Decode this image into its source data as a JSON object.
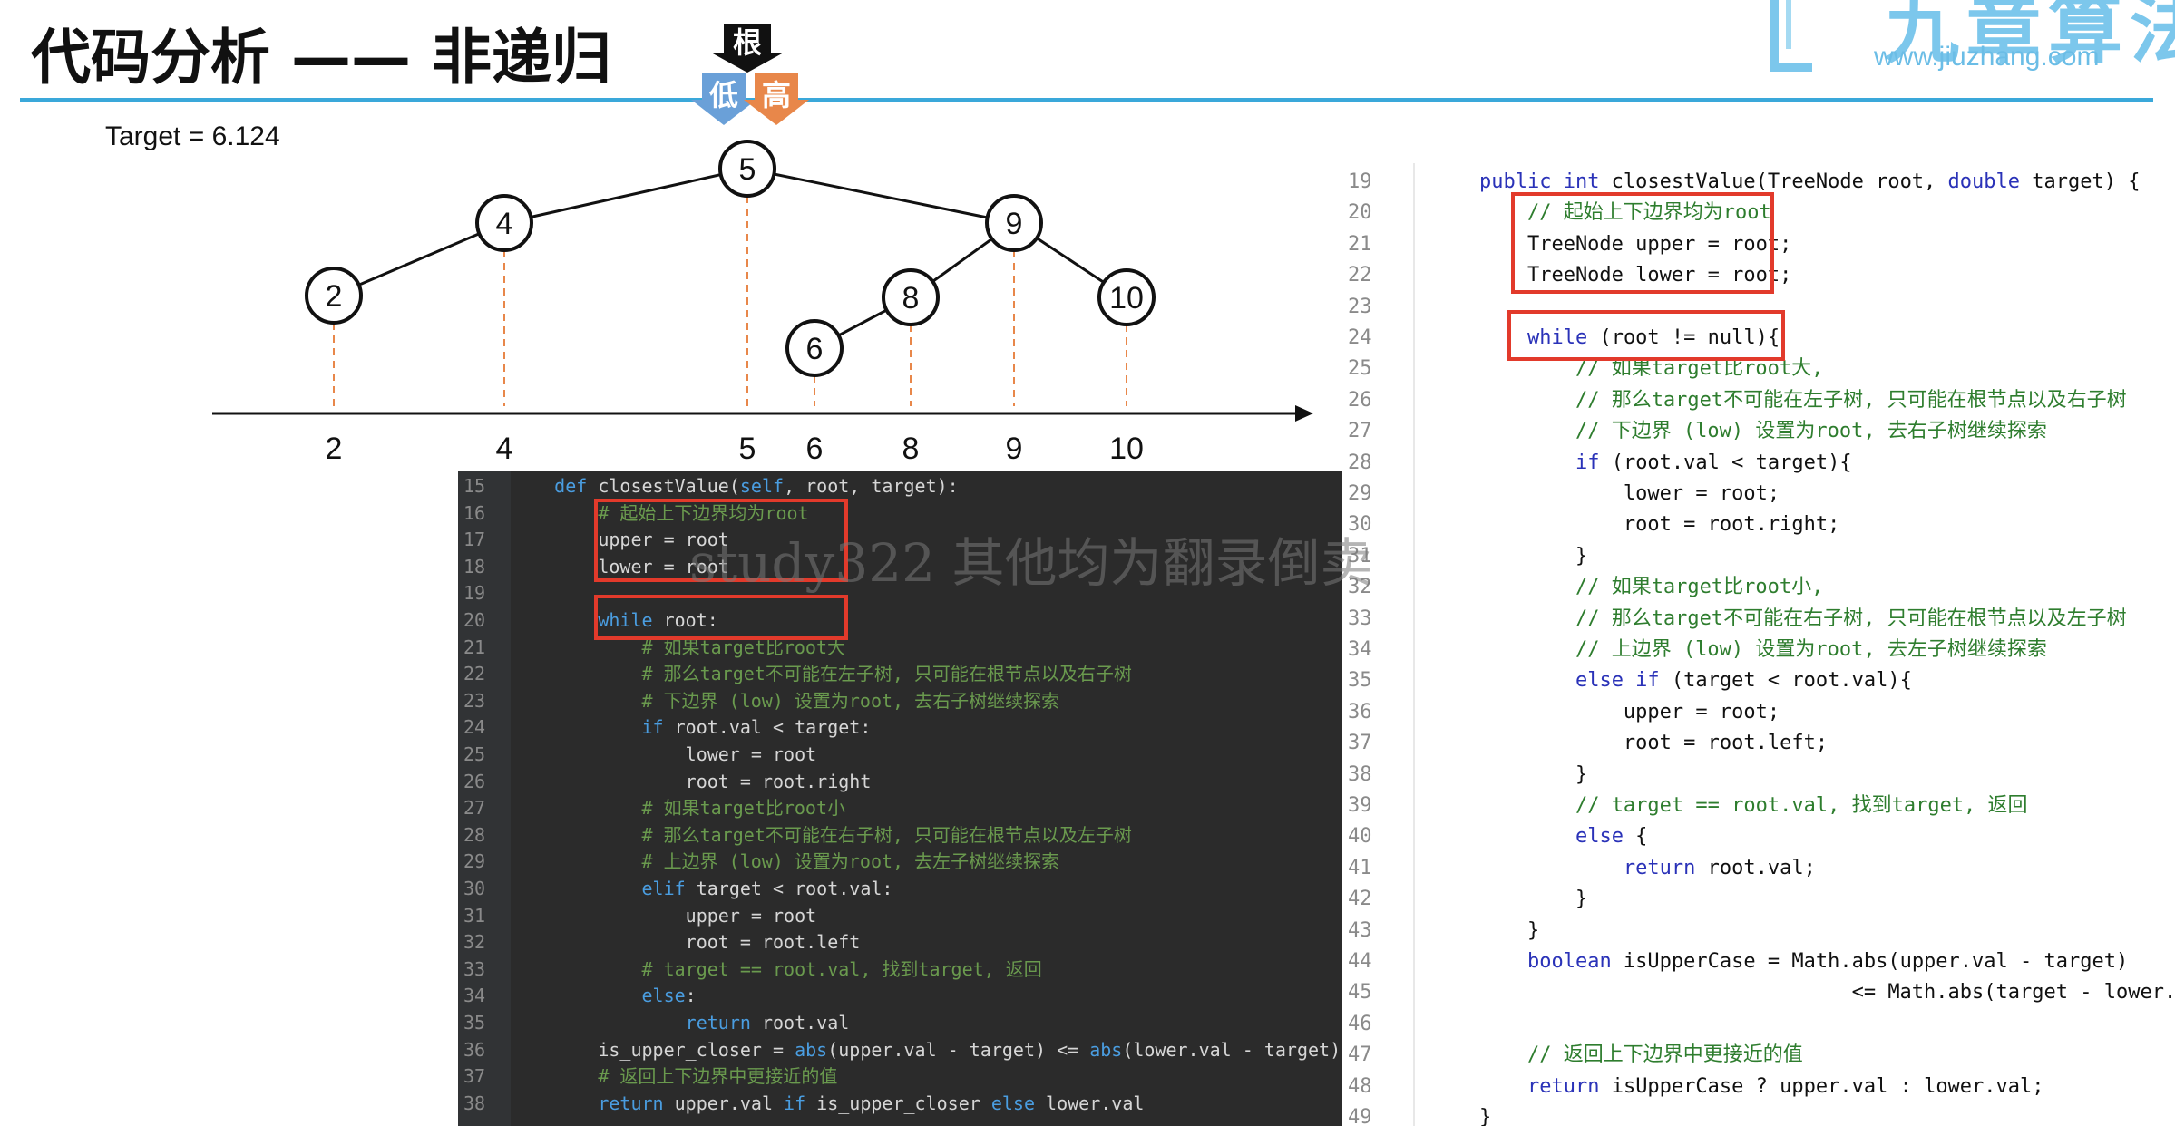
{
  "slide": {
    "title": "代码分析 —— 非递归",
    "target_label": "Target = 6.124"
  },
  "logo": {
    "name_cn": "九章算法",
    "url": "www.jiuzhang.com",
    "color": "#6bbde6"
  },
  "pointers": {
    "root_label": "根",
    "low_label": "低",
    "high_label": "高",
    "low_color": "#6aa0d8",
    "high_color": "#e8874a"
  },
  "tree": {
    "nodes": [
      "2",
      "4",
      "5",
      "6",
      "8",
      "9",
      "10"
    ],
    "edges": [
      [
        "5",
        "4"
      ],
      [
        "4",
        "2"
      ],
      [
        "5",
        "9"
      ],
      [
        "9",
        "8"
      ],
      [
        "8",
        "6"
      ],
      [
        "9",
        "10"
      ]
    ],
    "axis_labels": [
      "2",
      "4",
      "5",
      "6",
      "8",
      "9",
      "10"
    ]
  },
  "python_code": {
    "first_line": 15,
    "lines": [
      [
        {
          "t": "    "
        },
        {
          "t": "def ",
          "c": "kw"
        },
        {
          "t": "closestValue("
        },
        {
          "t": "self",
          "c": "kw"
        },
        {
          "t": ", root, target):"
        }
      ],
      [
        {
          "t": "        "
        },
        {
          "t": "# 起始上下边界均为root",
          "c": "cm"
        }
      ],
      [
        {
          "t": "        upper = root"
        }
      ],
      [
        {
          "t": "        lower = root"
        }
      ],
      [
        {
          "t": ""
        }
      ],
      [
        {
          "t": "        "
        },
        {
          "t": "while",
          "c": "kw"
        },
        {
          "t": " root:"
        }
      ],
      [
        {
          "t": "            "
        },
        {
          "t": "# 如果target比root大",
          "c": "cm"
        }
      ],
      [
        {
          "t": "            "
        },
        {
          "t": "# 那么target不可能在左子树, 只可能在根节点以及右子树",
          "c": "cm"
        }
      ],
      [
        {
          "t": "            "
        },
        {
          "t": "# 下边界 (low) 设置为root, 去右子树继续探索",
          "c": "cm"
        }
      ],
      [
        {
          "t": "            "
        },
        {
          "t": "if",
          "c": "kw"
        },
        {
          "t": " root.val < target:"
        }
      ],
      [
        {
          "t": "                lower = root"
        }
      ],
      [
        {
          "t": "                root = root.right"
        }
      ],
      [
        {
          "t": "            "
        },
        {
          "t": "# 如果target比root小",
          "c": "cm"
        }
      ],
      [
        {
          "t": "            "
        },
        {
          "t": "# 那么target不可能在右子树, 只可能在根节点以及左子树",
          "c": "cm"
        }
      ],
      [
        {
          "t": "            "
        },
        {
          "t": "# 上边界 (low) 设置为root, 去左子树继续探索",
          "c": "cm"
        }
      ],
      [
        {
          "t": "            "
        },
        {
          "t": "elif",
          "c": "kw"
        },
        {
          "t": " target < root.val:"
        }
      ],
      [
        {
          "t": "                upper = root"
        }
      ],
      [
        {
          "t": "                root = root.left"
        }
      ],
      [
        {
          "t": "            "
        },
        {
          "t": "# target == root.val, 找到target, 返回",
          "c": "cm"
        }
      ],
      [
        {
          "t": "            "
        },
        {
          "t": "else",
          "c": "kw"
        },
        {
          "t": ":"
        }
      ],
      [
        {
          "t": "                "
        },
        {
          "t": "return",
          "c": "kw"
        },
        {
          "t": " root.val"
        }
      ],
      [
        {
          "t": "        is_upper_closer = "
        },
        {
          "t": "abs",
          "c": "kw"
        },
        {
          "t": "(upper.val - target) <= "
        },
        {
          "t": "abs",
          "c": "kw"
        },
        {
          "t": "(lower.val - target)"
        }
      ],
      [
        {
          "t": "        "
        },
        {
          "t": "# 返回上下边界中更接近的值",
          "c": "cm"
        }
      ],
      [
        {
          "t": "        "
        },
        {
          "t": "return",
          "c": "kw"
        },
        {
          "t": " upper.val "
        },
        {
          "t": "if",
          "c": "kw"
        },
        {
          "t": " is_upper_closer "
        },
        {
          "t": "else",
          "c": "kw"
        },
        {
          "t": " lower.val"
        }
      ]
    ]
  },
  "java_code": {
    "first_line": 19,
    "lines": [
      [
        {
          "t": "    "
        },
        {
          "t": "public int",
          "c": "kw"
        },
        {
          "t": " closestValue(TreeNode root, "
        },
        {
          "t": "double",
          "c": "kw"
        },
        {
          "t": " target) {"
        }
      ],
      [
        {
          "t": "        "
        },
        {
          "t": "// 起始上下边界均为root",
          "c": "cm"
        }
      ],
      [
        {
          "t": "        TreeNode upper = root;"
        }
      ],
      [
        {
          "t": "        TreeNode lower = root;"
        }
      ],
      [
        {
          "t": ""
        }
      ],
      [
        {
          "t": "        "
        },
        {
          "t": "while",
          "c": "kw"
        },
        {
          "t": " (root != null){"
        }
      ],
      [
        {
          "t": "            "
        },
        {
          "t": "// 如果target比root大,",
          "c": "cm"
        }
      ],
      [
        {
          "t": "            "
        },
        {
          "t": "// 那么target不可能在左子树, 只可能在根节点以及右子树",
          "c": "cm"
        }
      ],
      [
        {
          "t": "            "
        },
        {
          "t": "// 下边界 (low) 设置为root, 去右子树继续探索",
          "c": "cm"
        }
      ],
      [
        {
          "t": "            "
        },
        {
          "t": "if",
          "c": "kw"
        },
        {
          "t": " (root.val < target){"
        }
      ],
      [
        {
          "t": "                lower = root;"
        }
      ],
      [
        {
          "t": "                root = root.right;"
        }
      ],
      [
        {
          "t": "            }"
        }
      ],
      [
        {
          "t": "            "
        },
        {
          "t": "// 如果target比root小,",
          "c": "cm"
        }
      ],
      [
        {
          "t": "            "
        },
        {
          "t": "// 那么target不可能在右子树, 只可能在根节点以及左子树",
          "c": "cm"
        }
      ],
      [
        {
          "t": "            "
        },
        {
          "t": "// 上边界 (low) 设置为root, 去左子树继续探索",
          "c": "cm"
        }
      ],
      [
        {
          "t": "            "
        },
        {
          "t": "else if",
          "c": "kw"
        },
        {
          "t": " (target < root.val){"
        }
      ],
      [
        {
          "t": "                upper = root;"
        }
      ],
      [
        {
          "t": "                root = root.left;"
        }
      ],
      [
        {
          "t": "            }"
        }
      ],
      [
        {
          "t": "            "
        },
        {
          "t": "// target == root.val, 找到target, 返回",
          "c": "cm"
        }
      ],
      [
        {
          "t": "            "
        },
        {
          "t": "else",
          "c": "kw"
        },
        {
          "t": " {"
        }
      ],
      [
        {
          "t": "                "
        },
        {
          "t": "return",
          "c": "kw"
        },
        {
          "t": " root.val;"
        }
      ],
      [
        {
          "t": "            }"
        }
      ],
      [
        {
          "t": "        }"
        }
      ],
      [
        {
          "t": "        "
        },
        {
          "t": "boolean",
          "c": "kw"
        },
        {
          "t": " isUpperCase = Math.abs(upper.val - target)"
        }
      ],
      [
        {
          "t": "                                   <= Math.abs(target - lower.val);"
        }
      ],
      [
        {
          "t": ""
        }
      ],
      [
        {
          "t": "        "
        },
        {
          "t": "// 返回上下边界中更接近的值",
          "c": "cm"
        }
      ],
      [
        {
          "t": "        "
        },
        {
          "t": "return",
          "c": "kw"
        },
        {
          "t": " isUpperCase ? upper.val : lower.val;"
        }
      ],
      [
        {
          "t": "    }"
        }
      ]
    ]
  },
  "watermark": "study322 其他均为翻录倒卖",
  "colors": {
    "title_rule": "#3aa8da",
    "highlight_box": "#e23a2b",
    "guide_line": "#e8874a",
    "py_background": "#2b2b2b",
    "py_keyword": "#4a9de0",
    "py_comment": "#6a9a4e",
    "java_keyword": "#2a32b8",
    "java_comment": "#2e7d2e"
  }
}
